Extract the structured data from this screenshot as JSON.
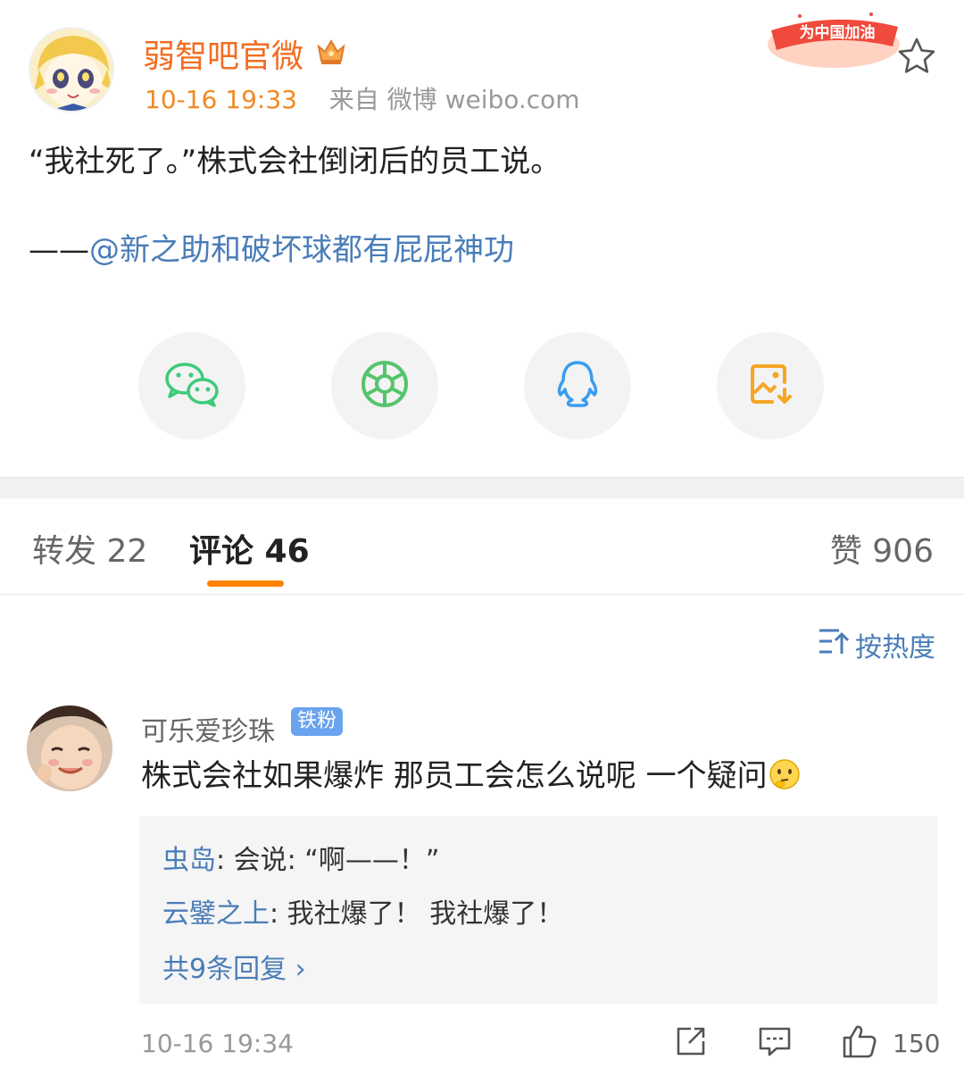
{
  "post": {
    "author": "弱智吧官微",
    "time": "10-16 19:33",
    "source": "来自 微博 weibo.com",
    "badge_text": "为中国加油",
    "text": "“我社死了。”株式会社倒闭后的员工说。",
    "source_prefix": "——",
    "source_mention": "@新之助和破坏球都有屁屁神功"
  },
  "share": {
    "items": [
      {
        "name": "wechat-icon"
      },
      {
        "name": "moments-icon"
      },
      {
        "name": "qq-icon"
      },
      {
        "name": "save-image-icon"
      }
    ]
  },
  "tabs": {
    "repost": "转发 22",
    "comments": "评论 46",
    "likes": "赞 906"
  },
  "sort": {
    "label": "按热度"
  },
  "comment": {
    "author": "可乐爱珍珠",
    "badge": "铁粉",
    "text": "株式会社如果爆炸 那员工会怎么说呢 一个疑问",
    "replies": [
      {
        "author": "虫岛",
        "sep": ": ",
        "text": "会说: “啊——！”"
      },
      {
        "author": "云鐾之上",
        "sep": ": ",
        "text": "我社爆了！ 我社爆了！"
      }
    ],
    "more_replies": "共9条回复 ›",
    "time": "10-16 19:34",
    "like_count": "150"
  },
  "colors": {
    "author": "#f26d22",
    "link": "#4a7db8",
    "tab_accent": "#ff8200",
    "fan_badge": "#6aa3ee"
  }
}
